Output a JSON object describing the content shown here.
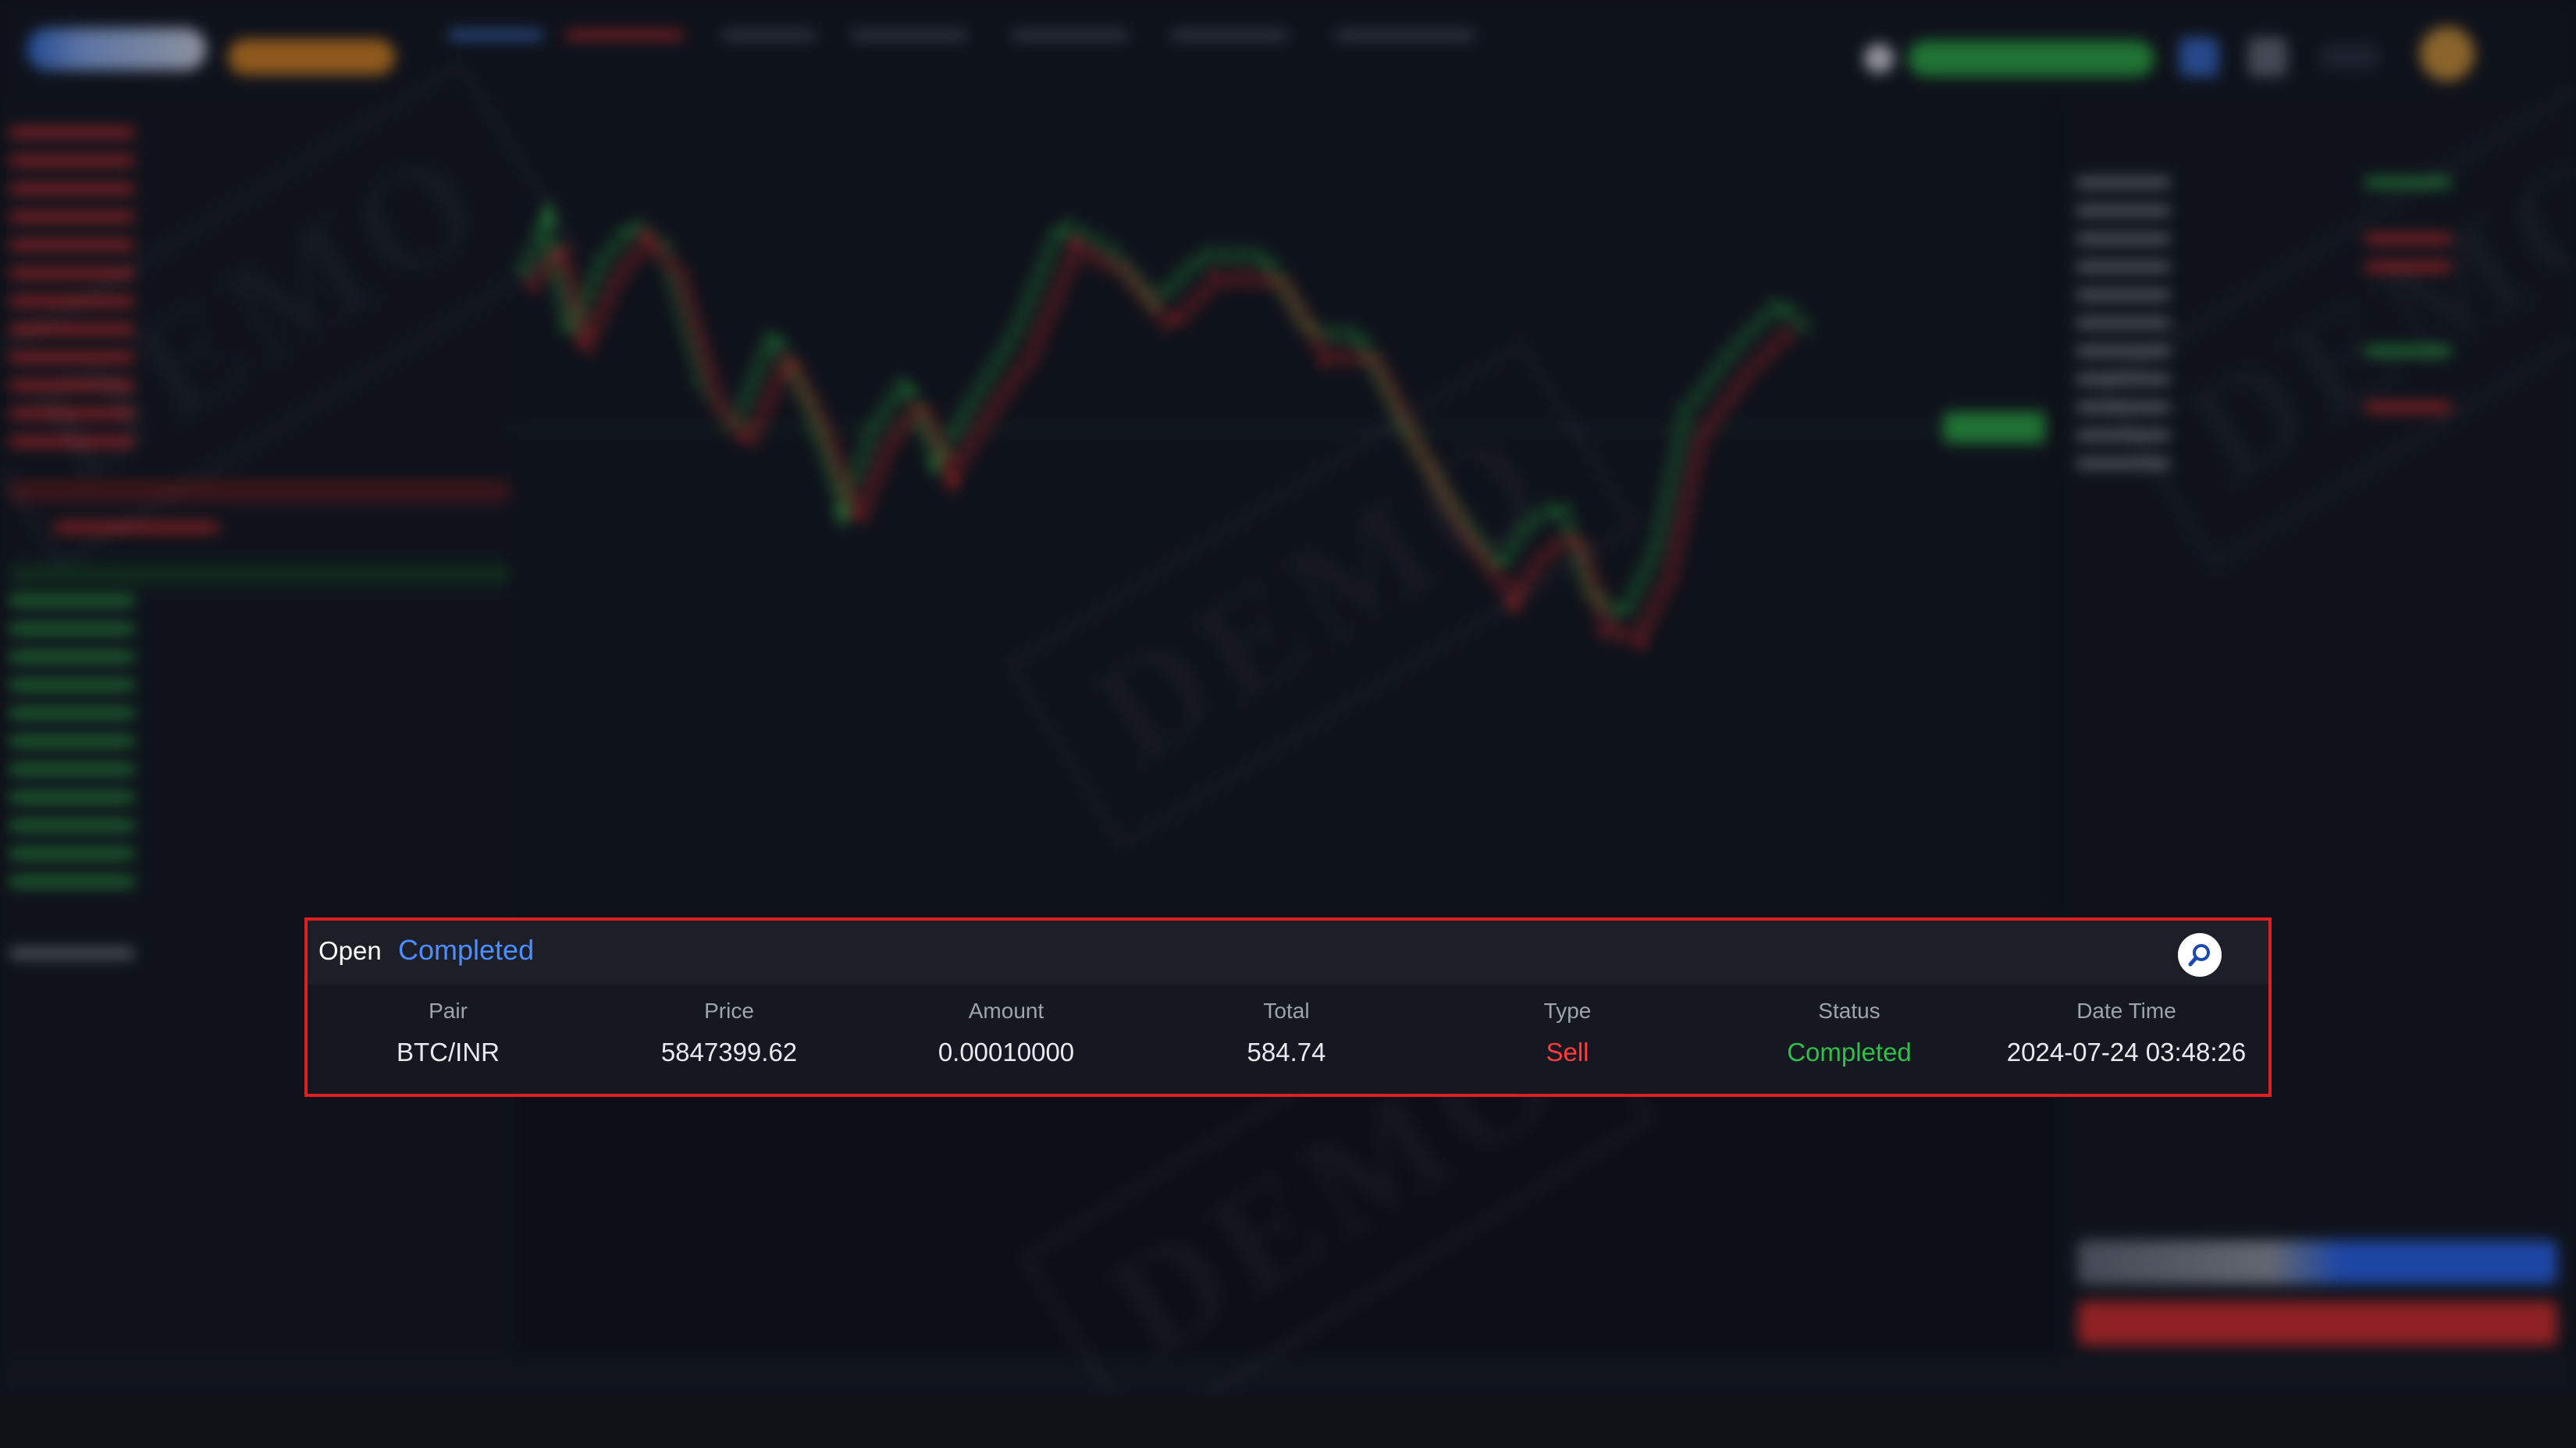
{
  "orders": {
    "tabs": {
      "open": "Open",
      "completed": "Completed"
    },
    "search_icon": "search-icon",
    "columns": [
      "Pair",
      "Price",
      "Amount",
      "Total",
      "Type",
      "Status",
      "Date Time"
    ],
    "rows": [
      [
        "BTC/INR",
        "5847399.62",
        "0.00010000",
        "584.74",
        "Sell",
        "Completed",
        "2024-07-24 03:48:26"
      ]
    ]
  },
  "colors": {
    "panel_border": "#e01f1f",
    "active_tab": "#4d8dff",
    "sell": "#ff3b3b",
    "completed": "#2fbf4a",
    "bullish": "#2fb34a",
    "bearish": "#e23030"
  }
}
